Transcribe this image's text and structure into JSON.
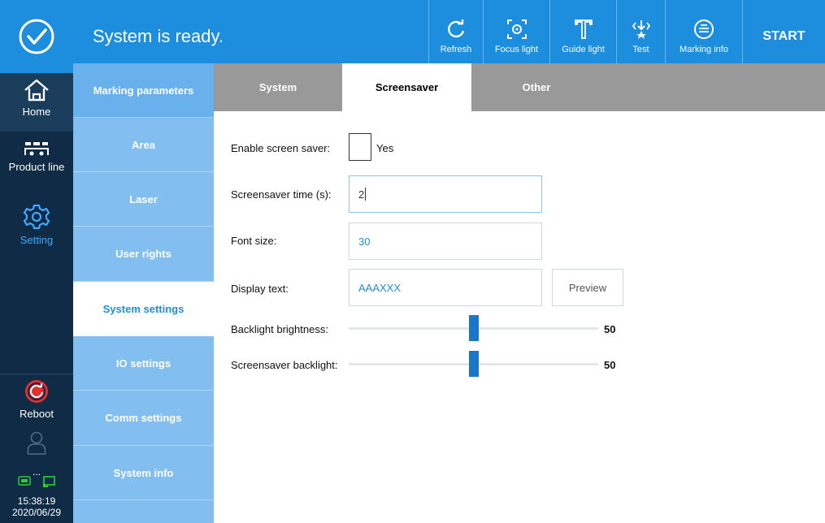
{
  "header": {
    "status_text": "System is ready.",
    "status_icon": "check-circle-icon",
    "tools": [
      {
        "label": "Refresh",
        "icon": "refresh-icon"
      },
      {
        "label": "Focus light",
        "icon": "focus-light-icon"
      },
      {
        "label": "Guide light",
        "icon": "guide-light-icon"
      },
      {
        "label": "Test",
        "icon": "test-icon"
      },
      {
        "label": "Marking info",
        "icon": "marking-info-icon"
      }
    ],
    "start_label": "START"
  },
  "nav": {
    "home": "Home",
    "product_line": "Product line",
    "setting": "Setting",
    "reboot": "Reboot",
    "user_placeholder": "...",
    "time": "15:38:19",
    "date": "2020/06/29"
  },
  "settings_menu": {
    "items": [
      {
        "label": "Marking parameters"
      },
      {
        "label": "Area"
      },
      {
        "label": "Laser"
      },
      {
        "label": "User rights"
      },
      {
        "label": "System settings"
      },
      {
        "label": "IO settings"
      },
      {
        "label": "Comm settings"
      },
      {
        "label": "System info"
      }
    ],
    "active_index": 4
  },
  "tabs": [
    {
      "label": "System"
    },
    {
      "label": "Screensaver"
    },
    {
      "label": "Other"
    }
  ],
  "form": {
    "enable_label": "Enable screen saver:",
    "enable_option": "Yes",
    "enable_checked": false,
    "time_label": "Screensaver time (s):",
    "time_value": "2",
    "font_label": "Font size:",
    "font_value": "30",
    "text_label": "Display text:",
    "text_value": "AAAXXX",
    "preview_label": "Preview",
    "backlight_label": "Backlight brightness:",
    "backlight_value": "50",
    "backlight_level": 0.5,
    "ss_backlight_label": "Screensaver backlight:",
    "ss_backlight_value": "50",
    "ss_backlight_level": 0.5
  },
  "colors": {
    "topbar": "#1d8ede",
    "nav_bg": "#0f2b45",
    "menu_bg": "#82bff0",
    "tab_bg": "#999999",
    "accent": "#1877c9"
  }
}
